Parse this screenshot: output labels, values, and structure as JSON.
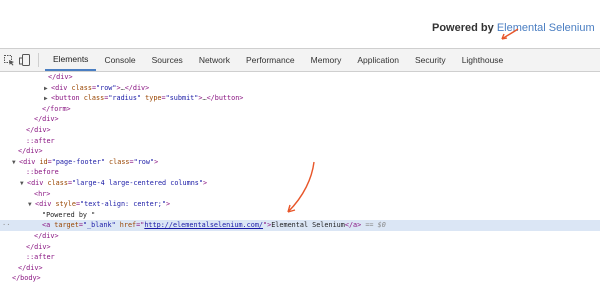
{
  "page": {
    "powered_label": "Powered by",
    "powered_link": "Elemental Selenium"
  },
  "devtools": {
    "tabs": [
      "Elements",
      "Console",
      "Sources",
      "Network",
      "Performance",
      "Memory",
      "Application",
      "Security",
      "Lighthouse"
    ],
    "active_tab": "Elements"
  },
  "tree": {
    "l1": "</div>",
    "l2_open": "<div class=\"row\">",
    "l2_tag_open": "div",
    "l2_attr": "class",
    "l2_val": "\"row\"",
    "l2_close": "</div>",
    "l3_tag": "button",
    "l3_attr1": "class",
    "l3_val1": "\"radius\"",
    "l3_attr2": "type",
    "l3_val2": "\"submit\"",
    "l3_close": "</button>",
    "l4": "</form>",
    "l5": "</div>",
    "l6": "</div>",
    "l7": "::after",
    "l8": "</div>",
    "l9_tag": "div",
    "l9_attr1": "id",
    "l9_val1": "\"page-footer\"",
    "l9_attr2": "class",
    "l9_val2": "\"row\"",
    "l10": "::before",
    "l11_tag": "div",
    "l11_attr": "class",
    "l11_val": "\"large-4 large-centered columns\"",
    "l12": "<hr>",
    "l13_tag": "div",
    "l13_attr": "style",
    "l13_val": "\"text-align: center;\"",
    "l14": "\"Powered by \"",
    "l15_tag": "a",
    "l15_attr1": "target",
    "l15_val1": "\"_blank\"",
    "l15_attr2": "href",
    "l15_val2": "http://elementalselenium.com/",
    "l15_text": "Elemental Selenium",
    "l15_close": "</a>",
    "l15_eq": "== $0",
    "l16": "</div>",
    "l17": "</div>",
    "l18": "::after",
    "l19": "</div>",
    "l20": "</body>",
    "ellipsis": "…"
  },
  "colors": {
    "tag": "#881280",
    "attr_name": "#994500",
    "attr_value": "#1a1aa6",
    "link": "#4a7ec2",
    "selected_row": "#dbe6f5",
    "annotation_arrow": "#e8562a"
  }
}
